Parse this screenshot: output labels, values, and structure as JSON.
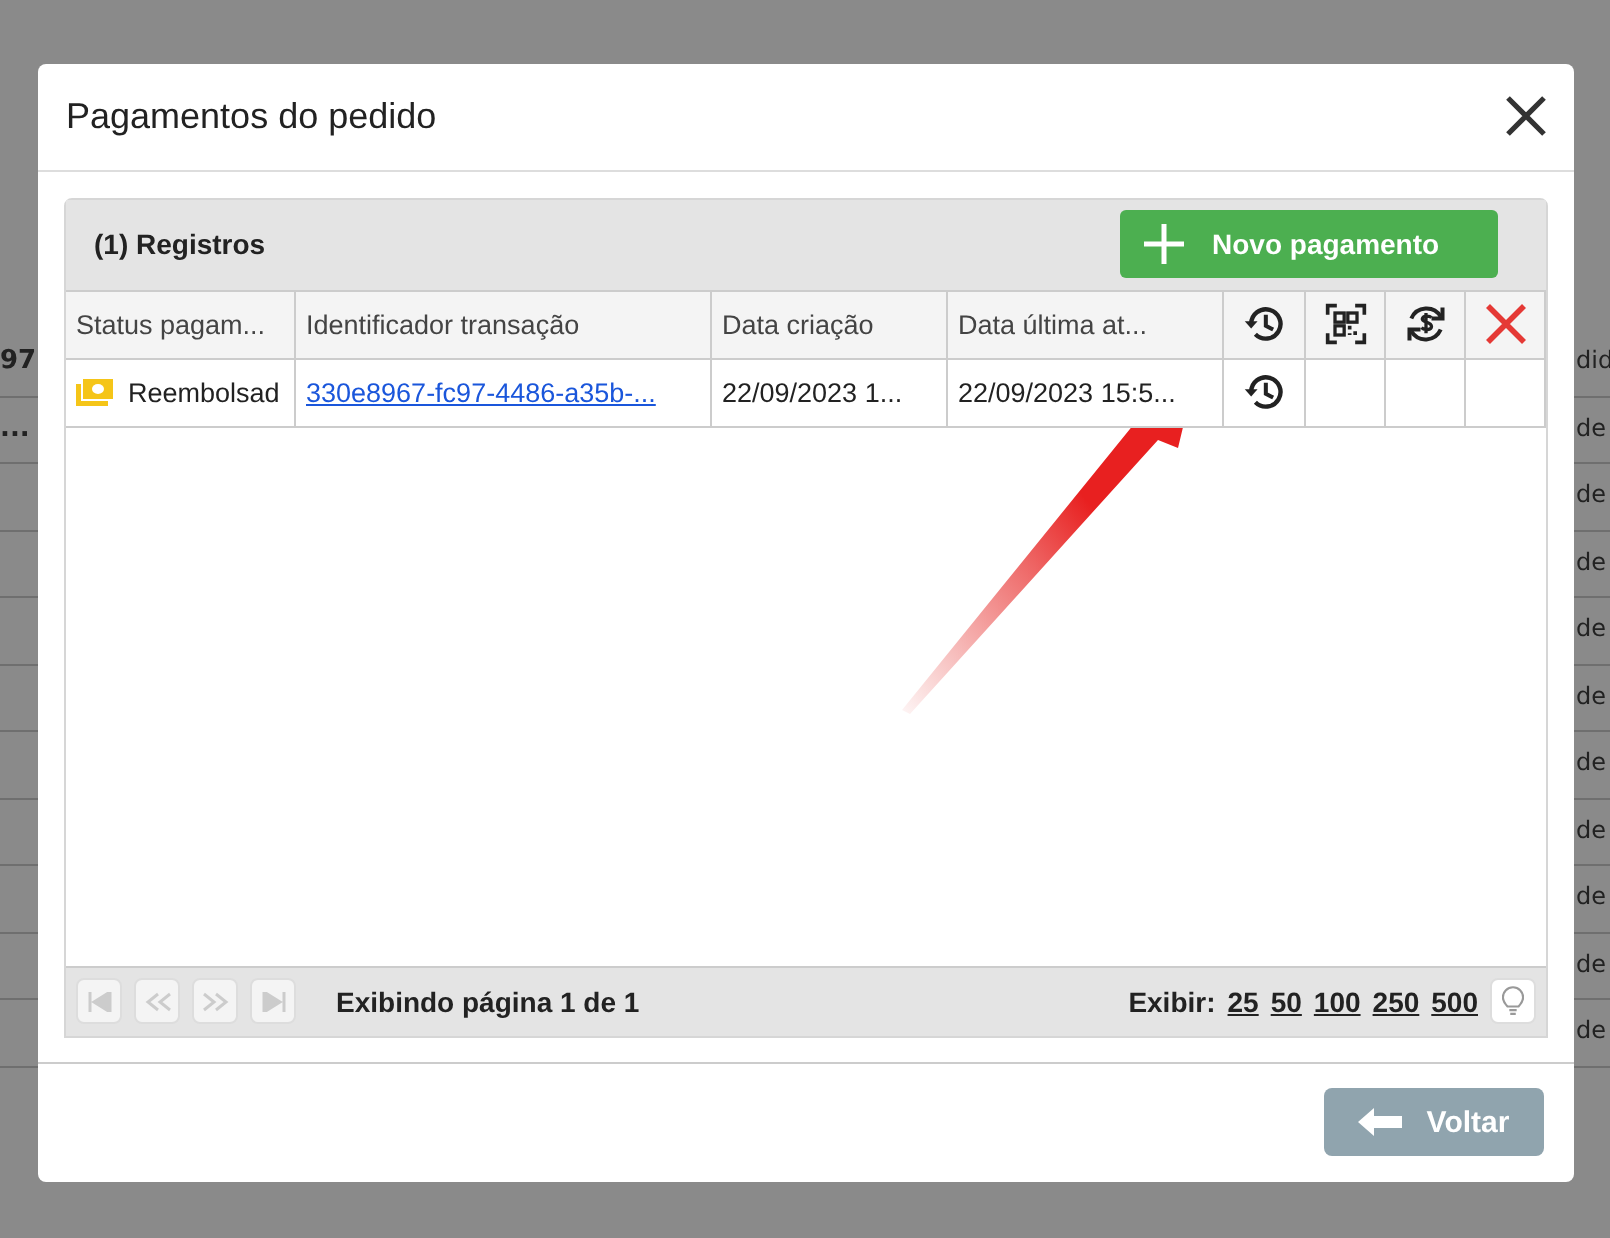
{
  "background": {
    "left_fragments": [
      "97",
      "..."
    ],
    "right_fragments": [
      "did",
      "de",
      "de",
      "de",
      "de",
      "de",
      "de",
      "de",
      "de",
      "de",
      "de"
    ]
  },
  "dialog": {
    "title": "Pagamentos do pedido"
  },
  "panel": {
    "count_label": "(1) Registros",
    "new_button": "Novo pagamento"
  },
  "table": {
    "columns": [
      {
        "kind": "text",
        "label": "Status pagam..."
      },
      {
        "kind": "text",
        "label": "Identificador transação"
      },
      {
        "kind": "text",
        "label": "Data criação"
      },
      {
        "kind": "text",
        "label": "Data última at..."
      },
      {
        "kind": "history"
      },
      {
        "kind": "qr"
      },
      {
        "kind": "refund"
      },
      {
        "kind": "delete"
      }
    ],
    "rows": [
      {
        "status": "Reembolsad",
        "transaction_id": "330e8967-fc97-4486-a35b-...",
        "created": "22/09/2023 1...",
        "updated": "22/09/2023 15:5...",
        "history": true
      }
    ]
  },
  "pager": {
    "info": "Exibindo página 1 de 1",
    "show_label": "Exibir:",
    "sizes": [
      "25",
      "50",
      "100",
      "250",
      "500"
    ]
  },
  "footer": {
    "back_button": "Voltar"
  }
}
